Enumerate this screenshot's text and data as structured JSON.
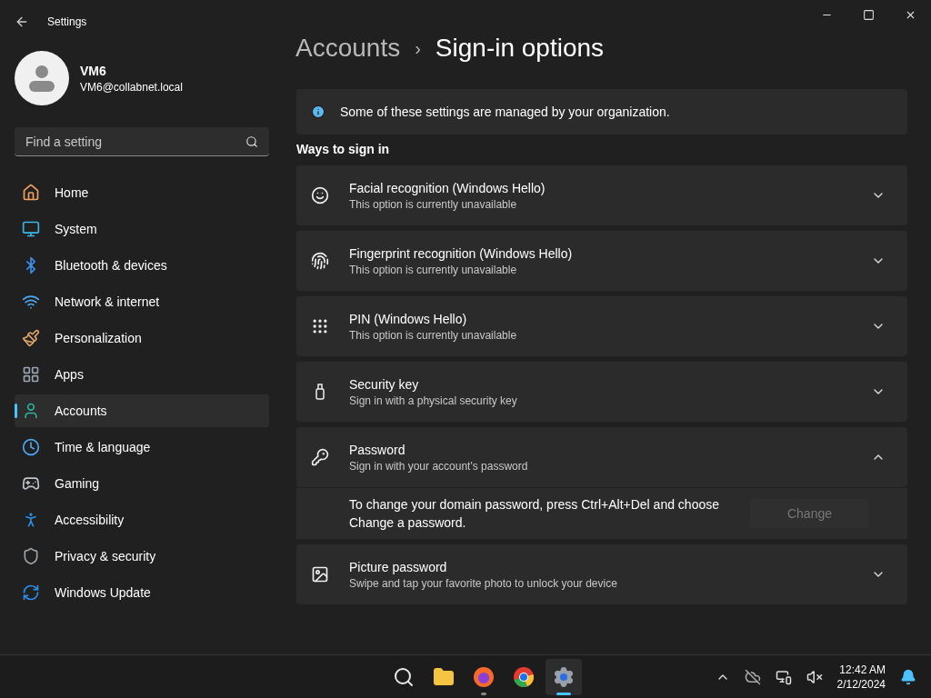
{
  "window": {
    "title": "Settings"
  },
  "user": {
    "name": "VM6",
    "email": "VM6@collabnet.local"
  },
  "search": {
    "placeholder": "Find a setting"
  },
  "nav": [
    {
      "label": "Home",
      "selected": false
    },
    {
      "label": "System",
      "selected": false
    },
    {
      "label": "Bluetooth & devices",
      "selected": false
    },
    {
      "label": "Network & internet",
      "selected": false
    },
    {
      "label": "Personalization",
      "selected": false
    },
    {
      "label": "Apps",
      "selected": false
    },
    {
      "label": "Accounts",
      "selected": true
    },
    {
      "label": "Time & language",
      "selected": false
    },
    {
      "label": "Gaming",
      "selected": false
    },
    {
      "label": "Accessibility",
      "selected": false
    },
    {
      "label": "Privacy & security",
      "selected": false
    },
    {
      "label": "Windows Update",
      "selected": false
    }
  ],
  "breadcrumb": {
    "parent": "Accounts",
    "separator": "›",
    "current": "Sign-in options"
  },
  "notice": "Some of these settings are managed by your organization.",
  "section_title": "Ways to sign in",
  "options": [
    {
      "title": "Facial recognition (Windows Hello)",
      "subtitle": "This option is currently unavailable",
      "expanded": false
    },
    {
      "title": "Fingerprint recognition (Windows Hello)",
      "subtitle": "This option is currently unavailable",
      "expanded": false
    },
    {
      "title": "PIN (Windows Hello)",
      "subtitle": "This option is currently unavailable",
      "expanded": false
    },
    {
      "title": "Security key",
      "subtitle": "Sign in with a physical security key",
      "expanded": false
    },
    {
      "title": "Password",
      "subtitle": "Sign in with your account's password",
      "expanded": true,
      "detail": "To change your domain password, press Ctrl+Alt+Del and choose Change a password.",
      "button": {
        "label": "Change",
        "disabled": true
      }
    },
    {
      "title": "Picture password",
      "subtitle": "Swipe and tap your favorite photo to unlock your device",
      "expanded": false
    }
  ],
  "taskbar": {
    "apps": [
      {
        "running": false,
        "active": false
      },
      {
        "running": false,
        "active": false
      },
      {
        "running": true,
        "active": false
      },
      {
        "running": false,
        "active": false
      },
      {
        "running": true,
        "active": true
      }
    ],
    "time": "12:42 AM",
    "date": "2/12/2024"
  }
}
